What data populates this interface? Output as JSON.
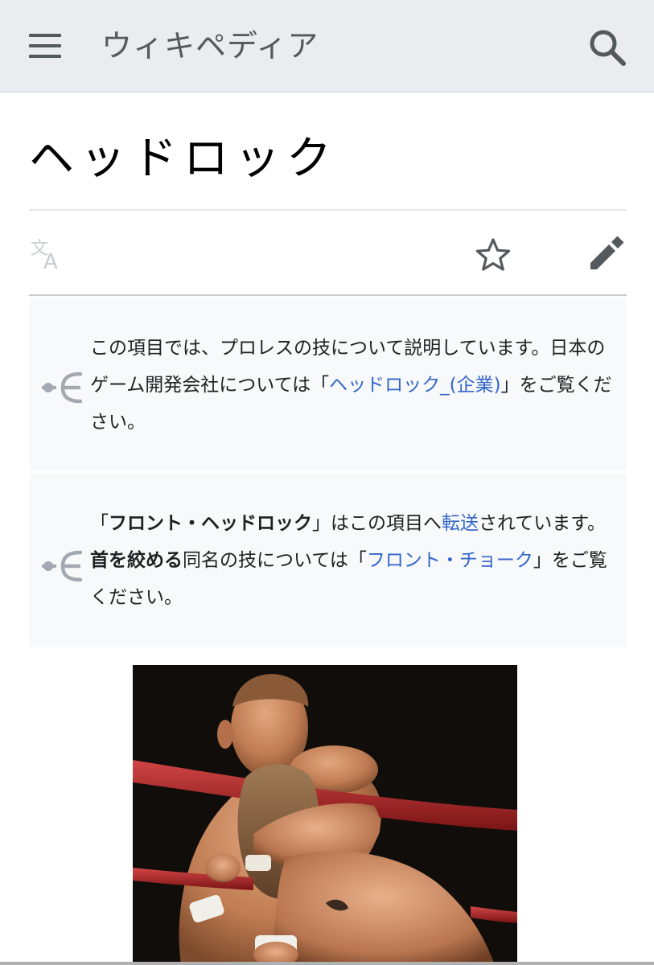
{
  "header": {
    "site_title": "ウィキペディア",
    "menu_icon": "hamburger-menu-icon",
    "search_icon": "search-icon",
    "background_color": "#eaecf0"
  },
  "article": {
    "title": "ヘッドロック"
  },
  "actions": {
    "language_icon": "language-icon",
    "watch_icon": "star-icon",
    "edit_icon": "pencil-icon"
  },
  "hatnotes": [
    {
      "icon": "disambiguation-icon",
      "parts": [
        {
          "text": "この項目では、プロレスの技について説明しています。日本のゲーム開発会社については「",
          "style": "plain"
        },
        {
          "text": "ヘッドロック_(企業)",
          "style": "link"
        },
        {
          "text": "」をご覧ください。",
          "style": "plain"
        }
      ]
    },
    {
      "icon": "disambiguation-icon",
      "parts": [
        {
          "text": "「",
          "style": "plain"
        },
        {
          "text": "フロント・ヘッドロック",
          "style": "bold"
        },
        {
          "text": "」はこの項目へ",
          "style": "plain"
        },
        {
          "text": "転送",
          "style": "link"
        },
        {
          "text": "されています。",
          "style": "plain"
        },
        {
          "text": "首を絞める",
          "style": "bold"
        },
        {
          "text": "同名の技については「",
          "style": "plain"
        },
        {
          "text": "フロント・チョーク",
          "style": "link"
        },
        {
          "text": "」をご覧ください。",
          "style": "plain"
        }
      ]
    }
  ],
  "colors": {
    "link": "#3366cc",
    "text": "#202122",
    "hatnote_background": "#f8f9fa",
    "icon_gray": "#54595d"
  }
}
